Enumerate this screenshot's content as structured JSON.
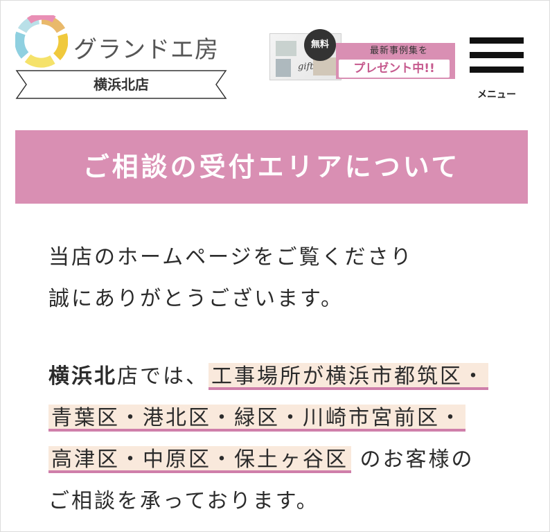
{
  "brand": {
    "name": "グランドエ房",
    "store": "横浜北店"
  },
  "promo": {
    "badge": "無料",
    "catalog_text": "gift",
    "line1": "最新事例集を",
    "line2": "プレゼント中!!"
  },
  "menu": {
    "label": "メニュー"
  },
  "section": {
    "title": "ご相談の受付エリアについて"
  },
  "body": {
    "para1_line1": "当店のホームページをご覧くださり",
    "para1_line2": "誠にありがとうございます。",
    "store_prefix": "横浜北",
    "store_suffix": "店では、",
    "area_line1": "工事場所が横浜市都筑区・",
    "area_line2": "青葉区・港北区・緑区・川崎市宮前区・",
    "area_line3": "高津区・中原区・保土ヶ谷区",
    "after_area": "のお客様の",
    "closing": "ご相談を承っております。"
  },
  "colors": {
    "accent_pink": "#d98fb3",
    "highlight_bg": "#f9e9dc",
    "underline": "#cf7faa"
  }
}
